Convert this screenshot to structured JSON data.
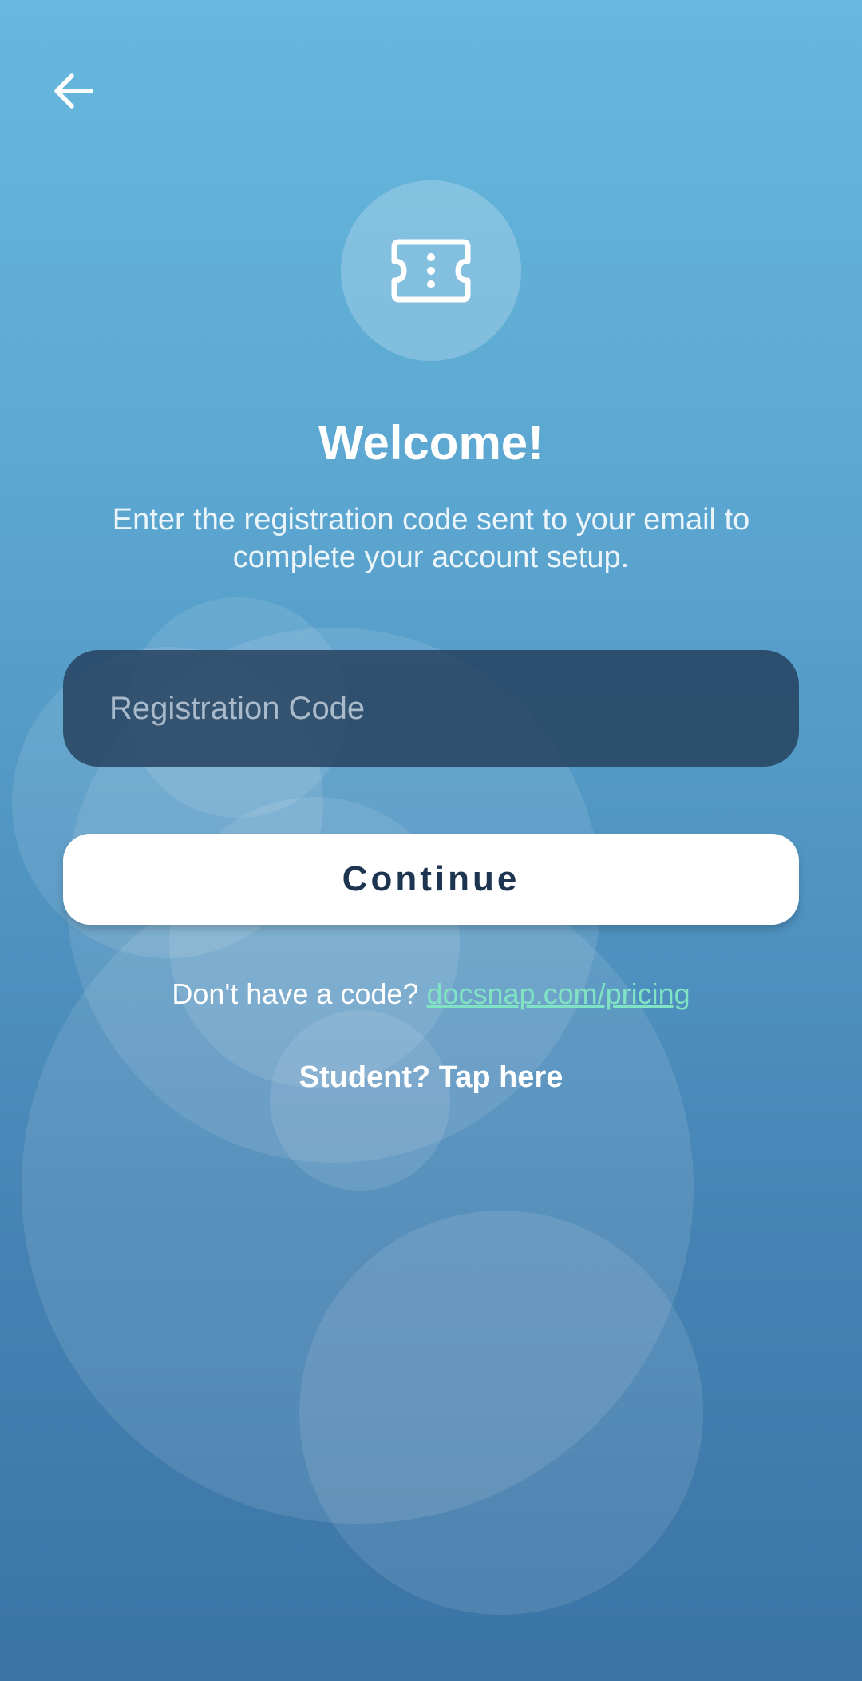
{
  "header": {
    "back_icon": "arrow-left-icon"
  },
  "hero": {
    "icon": "ticket-icon"
  },
  "welcome": {
    "title": "Welcome!",
    "subtitle": "Enter the registration code sent to your email to complete your account setup."
  },
  "form": {
    "code_placeholder": "Registration Code",
    "code_value": "",
    "continue_label": "Continue"
  },
  "footer": {
    "no_code_text": "Don't have a code?",
    "pricing_link": "docsnap.com/pricing",
    "student_link": "Student? Tap here"
  },
  "colors": {
    "background_top": "#66b8de",
    "background_bottom": "#3b74a5",
    "button_text": "#1d3550",
    "link": "#7fe3c4"
  }
}
